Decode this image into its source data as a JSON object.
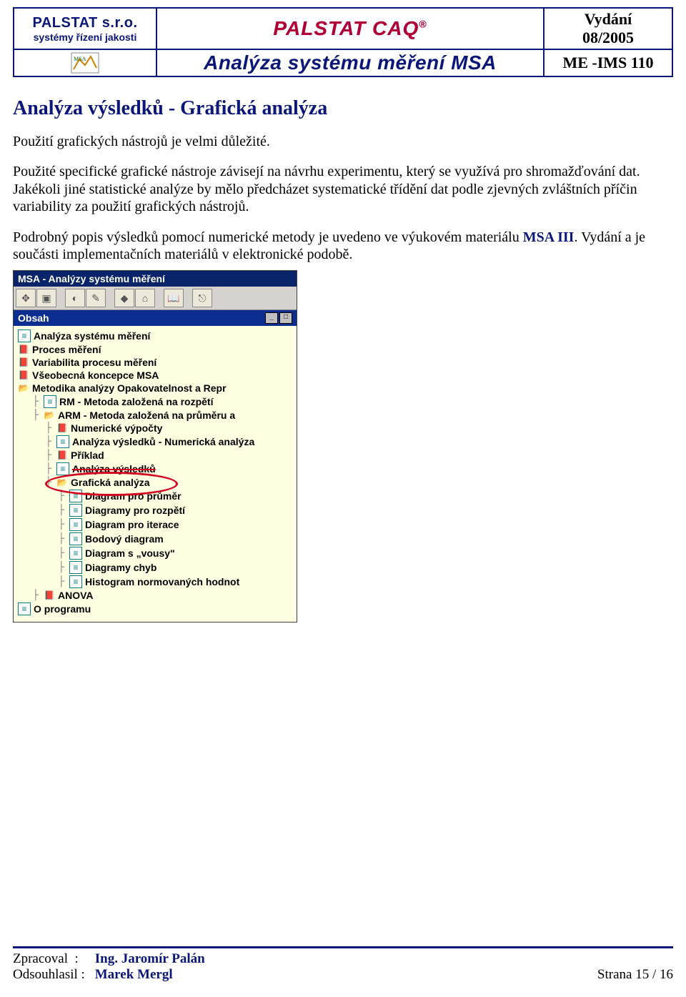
{
  "header": {
    "company_name": "PALSTAT s.r.o.",
    "company_sub": "systémy řízení jakosti",
    "product_title": "PALSTAT CAQ",
    "product_reg": "®",
    "subtitle": "Analýza systému měření MSA",
    "issue_label": "Vydání",
    "issue_date": "08/2005",
    "doc_code": "ME -IMS 110"
  },
  "body": {
    "heading": "Analýza výsledků - Grafická analýza",
    "p1": "Použití grafických nástrojů je velmi důležité.",
    "p2": "Použité specifické grafické nástroje závisejí na návrhu experimentu, který se využívá pro shromažďování dat. Jakékoli jiné statistické analýze by mělo předcházet systematické třídění dat podle zjevných zvláštních příčin variability za použití grafických nástrojů.",
    "p3a": "Podrobný popis výsledků pomocí numerické metody je uvedeno ve výukovém materiálu ",
    "p3link": "MSA III",
    "p3b": ". Vydání a je součásti implementačních materiálů v elektronické podobě."
  },
  "app": {
    "title": "MSA - Analýzy systému měření",
    "panel_label": "Obsah",
    "tree": [
      {
        "lvl": 1,
        "icon": "page",
        "label": "Analýza systému měření"
      },
      {
        "lvl": 1,
        "icon": "book",
        "label": "Proces měření"
      },
      {
        "lvl": 1,
        "icon": "book",
        "label": "Variabilita procesu měření"
      },
      {
        "lvl": 1,
        "icon": "book",
        "label": "Všeobecná koncepce MSA"
      },
      {
        "lvl": 1,
        "icon": "open",
        "label": "Metodika analýzy Opakovatelnost a Repr"
      },
      {
        "lvl": 2,
        "icon": "page",
        "label": "RM - Metoda založená na rozpětí"
      },
      {
        "lvl": 2,
        "icon": "open",
        "label": "ARM - Metoda založená na průměru a"
      },
      {
        "lvl": 3,
        "icon": "book",
        "label": "Numerické výpočty"
      },
      {
        "lvl": 3,
        "icon": "page",
        "label": "Analýza výsledků - Numerická analýza"
      },
      {
        "lvl": 3,
        "icon": "book",
        "label": "Příklad"
      },
      {
        "lvl": 3,
        "icon": "page",
        "label": "Analýza výsledků",
        "strike": true
      },
      {
        "lvl": 3,
        "icon": "open",
        "label": "Grafická analýza",
        "circled": true
      },
      {
        "lvl": 4,
        "icon": "page",
        "label": "Diagram pro průměr"
      },
      {
        "lvl": 4,
        "icon": "page",
        "label": "Diagramy pro rozpětí"
      },
      {
        "lvl": 4,
        "icon": "page",
        "label": "Diagram pro iterace"
      },
      {
        "lvl": 4,
        "icon": "page",
        "label": "Bodový diagram"
      },
      {
        "lvl": 4,
        "icon": "page",
        "label": "Diagram s „vousy\""
      },
      {
        "lvl": 4,
        "icon": "page",
        "label": "Diagramy chyb"
      },
      {
        "lvl": 4,
        "icon": "page",
        "label": "Histogram normovaných hodnot"
      },
      {
        "lvl": 2,
        "icon": "book",
        "label": "ANOVA"
      },
      {
        "lvl": 1,
        "icon": "page",
        "label": "O programu"
      }
    ]
  },
  "footer": {
    "author_label": "Zpracoval",
    "author_name": "Ing. Jaromír Palán",
    "approver_label": "Odsouhlasil",
    "approver_name": "Marek Mergl",
    "page_label": "Strana 15 / 16"
  }
}
